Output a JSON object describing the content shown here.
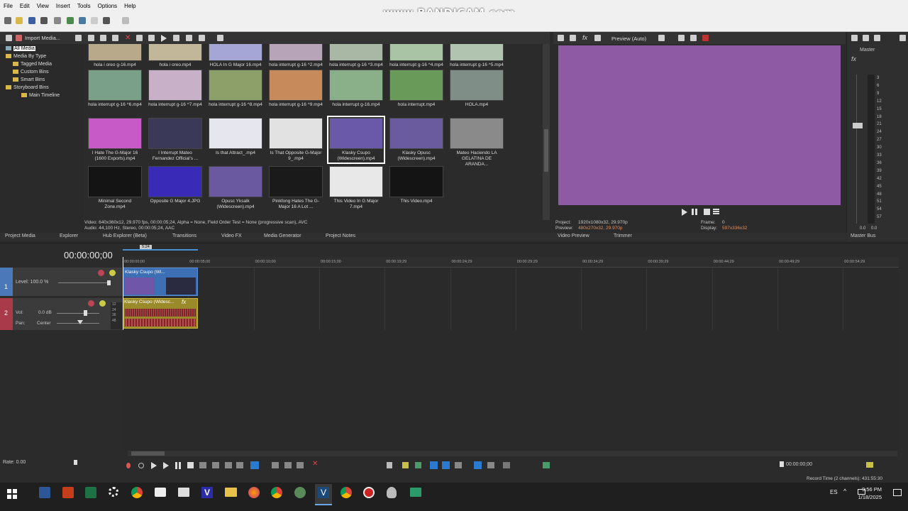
{
  "menu": [
    "File",
    "Edit",
    "View",
    "Insert",
    "Tools",
    "Options",
    "Help"
  ],
  "watermark": "www.BANDICAM.com",
  "explorer": {
    "import_label": "Import Media...",
    "tree": [
      "All Media",
      "Media By Type",
      "Tagged Media",
      "Custom Bins",
      "Smart Bins",
      "Storyboard Bins",
      "Main Timeline"
    ],
    "rows": [
      [
        {
          "name": "hola i oreo g-16.mp4",
          "color": "#b7a98a"
        },
        {
          "name": "hola i oreo.mp4",
          "color": "#c3b79a"
        },
        {
          "name": "HOLA In G Major 16.mp4",
          "color": "#a6a6d6"
        },
        {
          "name": "hola interrupt g-16 ^2.mp4",
          "color": "#b8a4b8"
        },
        {
          "name": "hola interrupt g-16 ^3.mp4",
          "color": "#a8b8a4"
        },
        {
          "name": "hola interrupt g-16 ^4.mp4",
          "color": "#a8c4a4"
        },
        {
          "name": "hola interrupt g-16 ^5.mp4",
          "color": "#b0c4b0"
        }
      ],
      [
        {
          "name": "hola interrupt g-16 ^6.mp4",
          "color": "#7aa08a"
        },
        {
          "name": "hola interrupt g-16 ^7.mp4",
          "color": "#c9b0c9"
        },
        {
          "name": "hola interrupt g-16 ^8.mp4",
          "color": "#8da06a"
        },
        {
          "name": "hola interrupt g-16 ^9.mp4",
          "color": "#c78a5a"
        },
        {
          "name": "hola interrupt g-16.mp4",
          "color": "#8ab08a"
        },
        {
          "name": "hola interrupt.mp4",
          "color": "#6a9a5a"
        },
        {
          "name": "HOLA.mp4",
          "color": "#7f8f88"
        }
      ],
      [
        {
          "name": "I Hate The G-Major 16 (1600 Exports).mp4",
          "color": "#c85ac8"
        },
        {
          "name": "I Interrupt Mateo Fernandez Official's ...",
          "color": "#3a3a58"
        },
        {
          "name": "Is that Attract_.mp4",
          "color": "#e6e6ee"
        },
        {
          "name": "Is That Opposite G-Major 9_.mp4",
          "color": "#e2e2e2"
        },
        {
          "name": "Klasky Csupo (Widescreen).mp4",
          "color": "#6a58a8"
        },
        {
          "name": "Klasky Opusc (Widescreen).mp4",
          "color": "#6a5a9e"
        },
        {
          "name": "Mateo Haciendo LA GELATINA DE ARANDA...",
          "color": "#8a8a8a"
        }
      ],
      [
        {
          "name": "Minimal Second Zone.mp4",
          "color": "#141414"
        },
        {
          "name": "Opposite G Major 4.JPG",
          "color": "#3a2ab8"
        },
        {
          "name": "Opusc Yksalk (Widescreen).mp4",
          "color": "#6a58a0"
        },
        {
          "name": "Pinkfong Hates The G-Major 16 A Lot ...",
          "color": "#1a1a1a"
        },
        {
          "name": "This Video In G Major 7.mp4",
          "color": "#e8e8e8"
        },
        {
          "name": "This Video.mp4",
          "color": "#141414"
        }
      ]
    ],
    "media_info_line1": "Video: 640x360x12, 29.970 fps, 00:00:05;24, Alpha = None, Field Order Test = None (progressive scan), AVC",
    "media_info_line2": "Audio: 44,100 Hz, Stereo, 00:00:05;24, AAC",
    "tabs": [
      "Project Media",
      "Explorer",
      "Hub Explorer (Beta)",
      "Transitions",
      "Video FX",
      "Media Generator",
      "Project Notes"
    ]
  },
  "preview": {
    "mode_label": "Preview (Auto)",
    "color": "#8e5aa3",
    "project_label": "Project:",
    "project_value": "1920x1080x32, 29.970p",
    "preview_label": "Preview:",
    "preview_value": "480x270x32, 29.970p",
    "frame_label": "Frame:",
    "frame_value": "0",
    "display_label": "Display:",
    "display_value": "597x336x32",
    "tabs": [
      "Video Preview",
      "Trimmer"
    ]
  },
  "master": {
    "title": "Master",
    "scale": [
      "3",
      "6",
      "9",
      "12",
      "15",
      "18",
      "21",
      "24",
      "27",
      "30",
      "33",
      "36",
      "39",
      "42",
      "45",
      "48",
      "51",
      "54",
      "57"
    ],
    "level_left": "0.0",
    "level_right": "0.0",
    "tab": "Master Bus"
  },
  "timeline": {
    "timecode": "00:00:00;00",
    "marker": "5;24",
    "ruler": [
      "00:00:00;00",
      "00:00:05;00",
      "00:00:10;00",
      "00:00:15;00",
      "00:00:19;29",
      "00:00:24;29",
      "00:00:29;29",
      "00:00:34;29",
      "00:00:39;29",
      "00:00:44;29",
      "00:00:49;29",
      "00:00:54;29"
    ],
    "video_track": {
      "number": "1",
      "level": "Level: 100.0 %"
    },
    "audio_track": {
      "number": "2",
      "vol_label": "Vol:",
      "vol_value": "0.0 dB",
      "pan_label": "Pan:",
      "pan_value": "Center",
      "meter": [
        "12",
        "24",
        "36",
        "48"
      ]
    },
    "video_clip": "Klasky Csupo (Wi...",
    "audio_clip": "Klasky Csupo (Widesc...",
    "rate": "Rate: 0.00",
    "end_time": "00:00:00;00",
    "record_time": "Record Time (2 channels): 431:55:30"
  },
  "taskbar": {
    "lang": "ES",
    "time": "9:56 PM",
    "date": "1/18/2025"
  }
}
